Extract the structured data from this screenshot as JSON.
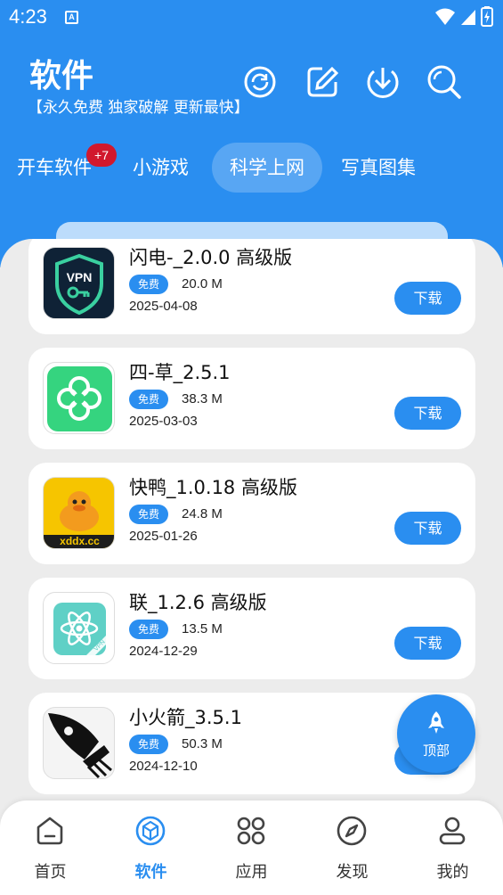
{
  "status_bar": {
    "time": "4:23",
    "app_glyph": "A"
  },
  "header": {
    "title": "软件",
    "subtitle": "【永久免费 独家破解 更新最快】",
    "icons": [
      "refresh-icon",
      "edit-icon",
      "download-icon",
      "search-icon"
    ]
  },
  "tabs": [
    {
      "label": "开车软件",
      "badge": "+7"
    },
    {
      "label": "小游戏"
    },
    {
      "label": "科学上网",
      "active": true
    },
    {
      "label": "写真图集"
    }
  ],
  "apps": [
    {
      "name": "闪电-_2.0.0 高级版",
      "tag": "免费",
      "size": "20.0 M",
      "date": "2025-04-08",
      "button": "下载",
      "icon": "vpn-shield-icon"
    },
    {
      "name": "四-草_2.5.1",
      "tag": "免费",
      "size": "38.3 M",
      "date": "2025-03-03",
      "button": "下载",
      "icon": "clover-icon"
    },
    {
      "name": "快鸭_1.0.18 高级版",
      "tag": "免费",
      "size": "24.8 M",
      "date": "2025-01-26",
      "button": "下载",
      "icon": "duck-icon",
      "icon_text": "xddx.cc"
    },
    {
      "name": "联_1.2.6 高级版",
      "tag": "免费",
      "size": "13.5 M",
      "date": "2024-12-29",
      "button": "下载",
      "icon": "atom-vpn-icon",
      "icon_text": "VPN"
    },
    {
      "name": "小火箭_3.5.1",
      "tag": "免费",
      "size": "50.3 M",
      "date": "2024-12-10",
      "button": "下载",
      "icon": "rocket-icon"
    }
  ],
  "fab": {
    "label": "顶部",
    "icon": "rocket-icon"
  },
  "bottom_nav": [
    {
      "label": "首页",
      "icon": "home-icon"
    },
    {
      "label": "软件",
      "icon": "cube-icon",
      "active": true
    },
    {
      "label": "应用",
      "icon": "apps-grid-icon"
    },
    {
      "label": "发现",
      "icon": "compass-icon"
    },
    {
      "label": "我的",
      "icon": "user-icon"
    }
  ],
  "colors": {
    "primary": "#2a8ef0",
    "badge": "#d1182d",
    "background": "#ececec"
  }
}
